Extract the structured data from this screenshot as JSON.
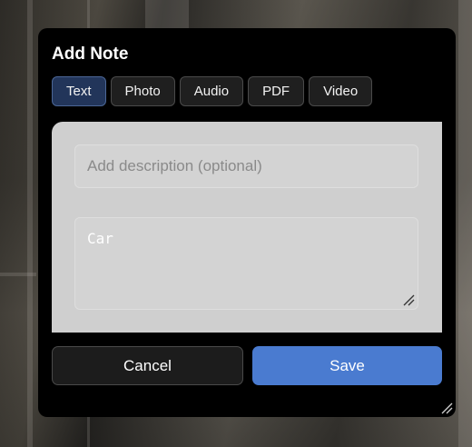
{
  "dialog": {
    "title": "Add Note",
    "tabs": [
      {
        "label": "Text",
        "active": true
      },
      {
        "label": "Photo",
        "active": false
      },
      {
        "label": "Audio",
        "active": false
      },
      {
        "label": "PDF",
        "active": false
      },
      {
        "label": "Video",
        "active": false
      }
    ],
    "description": {
      "placeholder": "Add description (optional)",
      "value": ""
    },
    "note_text": "Car",
    "cancel_label": "Cancel",
    "save_label": "Save"
  },
  "colors": {
    "dialog_bg": "#000000",
    "active_tab_bg": "#22355a",
    "save_button": "#4a7bd0",
    "panel_bg": "#cfcfcf"
  },
  "icons": [
    "resize-grip-icon",
    "dialog-resize-grip-icon"
  ]
}
